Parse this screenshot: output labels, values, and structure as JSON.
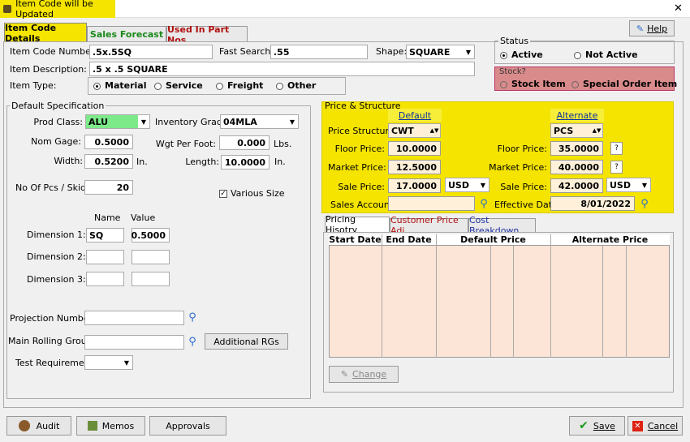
{
  "window": {
    "title": "Item Code will be Updated",
    "close_glyph": "✕"
  },
  "tabs": [
    {
      "label": "Item Code Details"
    },
    {
      "label": "Sales Forecast"
    },
    {
      "label": "Used In Part Nos"
    }
  ],
  "help_label": "Help",
  "header": {
    "item_code_label": "Item Code Number:",
    "item_code_value": ".5x.5SQ",
    "fast_search_label": "Fast Search:",
    "fast_search_value": ".55",
    "shape_label": "Shape:",
    "shape_value": "SQUARE",
    "desc_label": "Item Description:",
    "desc_value": ".5 x .5 SQUARE",
    "item_type_label": "Item Type:",
    "item_types": [
      "Material",
      "Service",
      "Freight",
      "Other"
    ]
  },
  "status": {
    "label": "Status",
    "active": "Active",
    "not_active": "Not Active",
    "stock_label": "Stock?",
    "stock_item": "Stock Item",
    "special_order": "Special Order Item"
  },
  "spec": {
    "group_label": "Default Specification",
    "prod_class_label": "Prod Class:",
    "prod_class_value": "ALU",
    "inventory_grade_label": "Inventory Grade:",
    "inventory_grade_value": "04MLA",
    "nom_gage_label": "Nom Gage:",
    "nom_gage_value": "0.5000",
    "wgt_per_foot_label": "Wgt Per Foot:",
    "wgt_per_foot_value": "0.000",
    "lbs": "Lbs.",
    "width_label": "Width:",
    "width_value": "0.5200",
    "in1": "In.",
    "length_label": "Length:",
    "length_value": "10.0000",
    "in2": "In.",
    "pcs_skid_label": "No Of Pcs / Skid:",
    "pcs_skid_value": "20",
    "various_size": "Various Size",
    "name_header": "Name",
    "value_header": "Value",
    "dim1_label": "Dimension 1:",
    "dim1_name": "SQ",
    "dim1_value": "0.5000",
    "dim2_label": "Dimension 2:",
    "dim3_label": "Dimension 3:"
  },
  "lower_left": {
    "projection_label": "Projection Number:",
    "rolling_group_label": "Main Rolling Group:",
    "additional_rgs": "Additional RGs",
    "test_req_label": "Test Requirement:"
  },
  "price": {
    "group_label": "Price & Structure",
    "default_header": "Default",
    "alternate_header": "Alternate",
    "price_structure_label": "Price Structure:",
    "default_structure": "CWT",
    "alt_structure": "PCS",
    "floor_label": "Floor Price:",
    "default_floor": "10.0000",
    "alt_floor_label": "Floor Price:",
    "alt_floor": "35.0000",
    "market_label": "Market Price:",
    "default_market": "12.5000",
    "alt_market_label": "Market Price:",
    "alt_market": "40.0000",
    "sale_label": "Sale Price:",
    "default_sale": "17.0000",
    "default_currency": "USD",
    "alt_sale_label": "Sale Price:",
    "alt_sale": "42.0000",
    "alt_currency": "USD",
    "q": "?",
    "sales_account_label": "Sales Account:",
    "effective_date_label": "Effective Date:",
    "effective_date": "8/01/2022"
  },
  "subtabs": [
    {
      "label": "Pricing Hisotry"
    },
    {
      "label": "Customer Price Adj"
    },
    {
      "label": "Cost Breakdown"
    }
  ],
  "grid_headers": [
    "Start Date",
    "End Date",
    "Default Price",
    "Alternate Price"
  ],
  "change_label": "Change",
  "footer": {
    "audit": "Audit",
    "memos": "Memos",
    "approvals": "Approvals",
    "save": "Save",
    "cancel": "Cancel"
  }
}
